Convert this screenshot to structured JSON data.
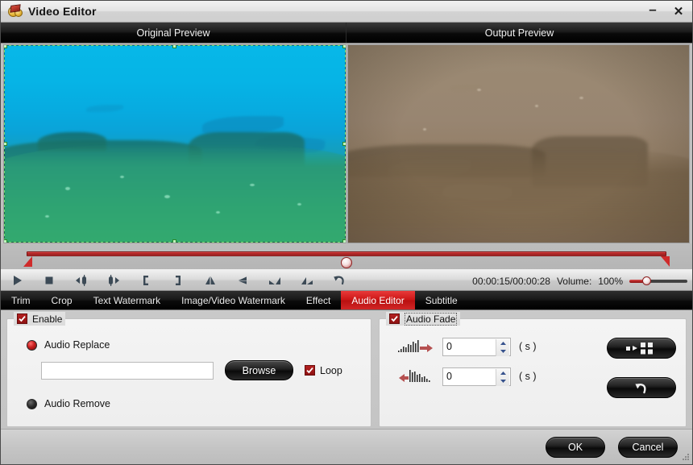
{
  "window": {
    "title": "Video Editor",
    "icon": "video-clip-icon",
    "minimize_label": "–",
    "close_label": "✕"
  },
  "preview": {
    "original_label": "Original Preview",
    "output_label": "Output Preview"
  },
  "timeline": {
    "start_marker": "trim-start-marker",
    "end_marker": "trim-end-marker",
    "playhead_position_percent": 50
  },
  "controls": {
    "buttons": [
      {
        "name": "play-button",
        "title": "Play"
      },
      {
        "name": "stop-button",
        "title": "Stop"
      },
      {
        "name": "previous-frame-button",
        "title": "Previous Frame"
      },
      {
        "name": "next-frame-button",
        "title": "Next Frame"
      },
      {
        "name": "set-start-button",
        "title": "Set Start"
      },
      {
        "name": "set-end-button",
        "title": "Set End"
      },
      {
        "name": "flip-vertical-button",
        "title": "Flip Vertical"
      },
      {
        "name": "flip-horizontal-button",
        "title": "Flip Horizontal"
      },
      {
        "name": "rotate-left-button",
        "title": "Rotate Left"
      },
      {
        "name": "rotate-right-button",
        "title": "Rotate Right"
      },
      {
        "name": "undo-button",
        "title": "Undo"
      }
    ],
    "timecode": "00:00:15/00:00:28",
    "volume_label": "Volume:",
    "volume_value": "100%",
    "volume_percent": 25
  },
  "tabs": [
    {
      "label": "Trim",
      "active": false
    },
    {
      "label": "Crop",
      "active": false
    },
    {
      "label": "Text Watermark",
      "active": false
    },
    {
      "label": "Image/Video Watermark",
      "active": false
    },
    {
      "label": "Effect",
      "active": false
    },
    {
      "label": "Audio Editor",
      "active": true
    },
    {
      "label": "Subtitle",
      "active": false
    }
  ],
  "audio_editor": {
    "enable_label": "Enable",
    "enable_checked": true,
    "audio_replace_label": "Audio Replace",
    "audio_replace_selected": true,
    "audio_remove_label": "Audio Remove",
    "audio_remove_selected": false,
    "path_value": "",
    "path_placeholder": "",
    "browse_label": "Browse",
    "loop_label": "Loop",
    "loop_checked": true
  },
  "audio_fade": {
    "legend_label": "Audio Fade",
    "legend_checked": true,
    "fade_in_icon": "fade-in-icon",
    "fade_out_icon": "fade-out-icon",
    "fade_in_value": "0",
    "fade_out_value": "0",
    "unit_label": "( s )",
    "apply_to_all_label": "apply-to-all-icon",
    "reset_label": "reset-icon"
  },
  "footer": {
    "ok_label": "OK",
    "cancel_label": "Cancel"
  },
  "colors": {
    "accent_red": "#cc1616",
    "tab_bar_black": "#0b0b0b",
    "panel_gray": "#c3c3c3"
  }
}
